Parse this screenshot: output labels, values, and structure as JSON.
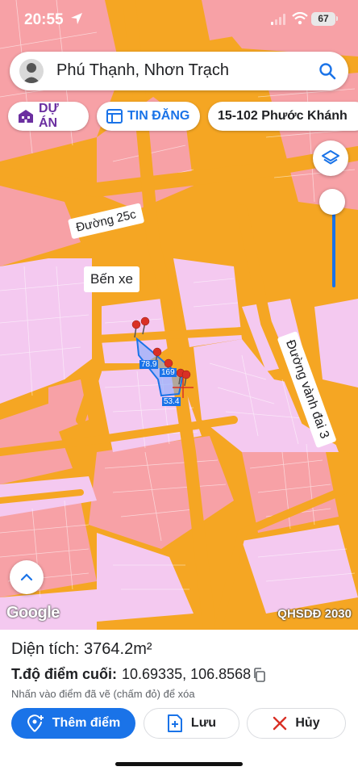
{
  "status": {
    "time": "20:55",
    "battery": "67"
  },
  "search": {
    "title": "Phú Thạnh, Nhơn Trạch"
  },
  "chips": [
    {
      "label": "DỰ ÁN"
    },
    {
      "label": "TIN ĐĂNG"
    },
    {
      "label": "15-102 Phước Khánh"
    }
  ],
  "map": {
    "labels": {
      "road_25c": "Đường 25c",
      "bus_station": "Bến xe",
      "ring_road_3": "Đường vành đai 3"
    },
    "measurements": [
      "78.9",
      "169",
      "53.4"
    ],
    "attribution": "Google",
    "plan_badge": "QHSDĐ 2030"
  },
  "panel": {
    "area_label": "Diện tích:",
    "area_value": "3764.2m²",
    "coord_label": "T.độ điểm cuối:",
    "coord_value": "10.69335, 106.8568",
    "hint": "Nhấn vào điểm đã vẽ (chấm đỏ) để xóa",
    "add_label": "Thêm điểm",
    "save_label": "Lưu",
    "cancel_label": "Hủy"
  },
  "colors": {
    "accent": "#1a73e8",
    "road": "#f5a623",
    "residential": "#f7a1a6",
    "urban": "#f4c9f0",
    "pin": "#d93025"
  },
  "icons": [
    "location-arrow-icon",
    "signal-icon",
    "wifi-icon",
    "battery-icon",
    "search-icon",
    "building-icon",
    "listing-icon",
    "layers-icon",
    "chevron-up-icon",
    "pin-icon",
    "add-location-icon",
    "add-file-icon",
    "close-icon",
    "copy-icon"
  ]
}
